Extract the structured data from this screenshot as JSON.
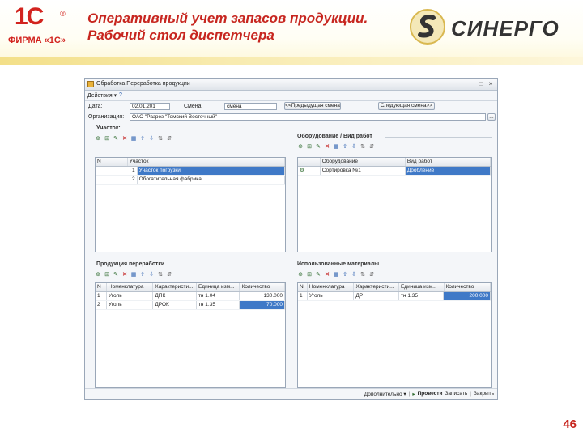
{
  "slide": {
    "logo_1c": "1С",
    "logo_1c_firm": "ФИРМА «1С»",
    "title": "Оперативный учет запасов продукции. Рабочий стол диспетчера",
    "partner_logo": "СИНЕРГО",
    "page_number": "46"
  },
  "window": {
    "title": "Обработка  Переработка продукции",
    "actions_label": "Действия ▾",
    "date_label": "Дата:",
    "date_value": "02.01.201",
    "shift_label": "Смена:",
    "shift_value": "смена",
    "prev_shift_button": "<<Предыдущая смена",
    "next_shift_button": "Следующая смена>>",
    "org_label": "Организация:",
    "org_value": "ОАО \"Разрез \"Томский Восточный\"",
    "status": {
      "extra": "Дополнительно ▾",
      "post": "Провести",
      "write": "Записать",
      "close": "Закрыть"
    }
  },
  "sections": {
    "sections_panel": {
      "title": "Участок:",
      "columns": [
        "N",
        "Участок"
      ],
      "rows": [
        {
          "n": "1",
          "name": "Участок погрузки"
        },
        {
          "n": "2",
          "name": "Обогатительная фабрика"
        }
      ]
    },
    "equipment_panel": {
      "title": "Оборудование / Вид работ",
      "columns": [
        "",
        "Оборудование",
        "Вид работ"
      ],
      "rows": [
        {
          "name": "Сортировка №1",
          "work": "Дробление"
        }
      ]
    },
    "products_panel": {
      "title": "Продукция переработки",
      "columns": [
        "N",
        "Номенклатура",
        "Характеристи...",
        "Единица изм...",
        "Количество"
      ],
      "rows": [
        {
          "n": "1",
          "item": "Уголь",
          "char": "ДПК",
          "unit": "тн 1.04",
          "qty": "130.000"
        },
        {
          "n": "2",
          "item": "Уголь",
          "char": "ДРОК",
          "unit": "тн 1.35",
          "qty": "70.000"
        }
      ]
    },
    "materials_panel": {
      "title": "Использованные материалы",
      "columns": [
        "N",
        "Номенклатура",
        "Характеристи...",
        "Единица изм...",
        "Количество"
      ],
      "rows": [
        {
          "n": "1",
          "item": "Уголь",
          "char": "ДР",
          "unit": "тн 1.35",
          "qty": "200.000"
        }
      ]
    }
  },
  "icons": {
    "toolbar": [
      "add-icon",
      "add-copy-icon",
      "edit-icon",
      "delete-icon",
      "end-edit-icon",
      "move-up-icon",
      "move-down-icon",
      "sort-asc-icon",
      "sort-desc-icon"
    ]
  }
}
